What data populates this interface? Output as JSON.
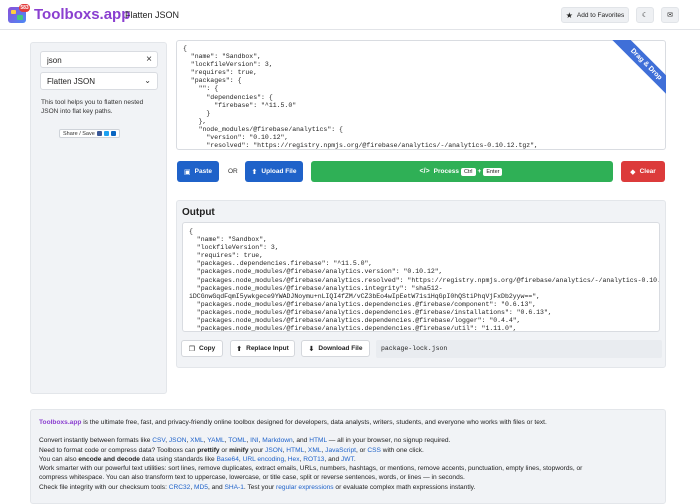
{
  "header": {
    "logo_badge": "583",
    "brand": "Toolboxs.app",
    "tool_title": "Flatten JSON",
    "favorites_label": "Add to Favorites",
    "theme_icon": "moon-icon",
    "mail_icon": "envelope-icon"
  },
  "sidebar": {
    "search_value": "json",
    "selected_tool": "Flatten JSON",
    "description": "This tool helps you to flatten nested JSON into flat key paths.",
    "share_label": "Share / Save"
  },
  "input": {
    "ribbon": "Drag & Drop",
    "code": "{\n  \"name\": \"Sandbox\",\n  \"lockfileVersion\": 3,\n  \"requires\": true,\n  \"packages\": {\n    \"\": {\n      \"dependencies\": {\n        \"firebase\": \"^11.5.0\"\n      }\n    },\n    \"node_modules/@firebase/analytics\": {\n      \"version\": \"0.10.12\",\n      \"resolved\": \"https://registry.npmjs.org/@firebase/analytics/-/analytics-0.10.12.tgz\","
  },
  "actions": {
    "paste": "Paste",
    "or": "OR",
    "upload": "Upload File",
    "process": "Process",
    "kbd_ctrl": "Ctrl",
    "plus": "+",
    "kbd_enter": "Enter",
    "clear": "Clear"
  },
  "output": {
    "title": "Output",
    "code": "{\n  \"name\": \"Sandbox\",\n  \"lockfileVersion\": 3,\n  \"requires\": true,\n  \"packages..dependencies.firebase\": \"^11.5.0\",\n  \"packages.node_modules/@firebase/analytics.version\": \"0.10.12\",\n  \"packages.node_modules/@firebase/analytics.resolved\": \"https://registry.npmjs.org/@firebase/analytics/-/analytics-0.10.12.tgz\",\n  \"packages.node_modules/@firebase/analytics.integrity\": \"sha512-\niDCGnwGqdFqmI5ywkgece9YWADJNoymu+nLIQI4fZM/vCZ3bEo4wIpEetW71s1HqGpI0hQStiPhqVjFxDb2yyw==\",\n  \"packages.node_modules/@firebase/analytics.dependencies.@firebase/component\": \"0.6.13\",\n  \"packages.node_modules/@firebase/analytics.dependencies.@firebase/installations\": \"0.6.13\",\n  \"packages.node_modules/@firebase/analytics.dependencies.@firebase/logger\": \"0.4.4\",\n  \"packages.node_modules/@firebase/analytics.dependencies.@firebase/util\": \"1.11.0\",",
    "copy": "Copy",
    "replace": "Replace Input",
    "download": "Download File",
    "filename": "package-lock.json"
  },
  "info": {
    "lead_brand": "Toolboxs.app",
    "lead_rest": " is the ultimate free, fast, and privacy-friendly online toolbox designed for developers, data analysts, writers, students, and everyone who works with files or text.",
    "l1_a": "Convert instantly between formats like ",
    "l1_links": [
      "CSV",
      "JSON",
      "XML",
      "YAML",
      "TOML",
      "INI",
      "Markdown"
    ],
    "l1_and": "and",
    "l1_html": "HTML",
    "l1_b": " — all in your browser, no signup required.",
    "l2_a": "Need to format code or compress data? Toolboxs can ",
    "l2_prettify": "prettify",
    "l2_or": " or ",
    "l2_minify": "minify",
    "l2_b": " your ",
    "l2_links": [
      "JSON",
      "HTML",
      "XML",
      "JavaScript"
    ],
    "l2_or2": "or",
    "l2_css": "CSS",
    "l2_c": " with one click.",
    "l3_a": "You can also ",
    "l3_bold": "encode and decode",
    "l3_b": " data using standards like ",
    "l3_links": [
      "Base64",
      "URL encoding",
      "Hex",
      "ROT13"
    ],
    "l3_and": "and",
    "l3_jwt": "JWT",
    "l4": "Work smarter with our powerful text utilities: sort lines, remove duplicates, extract emails, URLs, numbers, hashtags, or mentions, remove accents, punctuation, empty lines, stopwords, or",
    "l5": "compress whitespace. You can also transform text to uppercase, lowercase, or title case, split or reverse sentences, words, or lines — in seconds.",
    "l6_a": "Check file integrity with our checksum tools: ",
    "l6_crc": "CRC32",
    "l6_md5": "MD5",
    "l6_and": "and",
    "l6_sha": "SHA-1",
    "l6_b": ". Test your ",
    "l6_regex": "regular expressions",
    "l6_c": " or evaluate complex math expressions instantly."
  },
  "colors": {
    "brand": "#8a3fd0",
    "primary": "#1f62c9",
    "process": "#2fb056",
    "clear": "#dc3b3b"
  }
}
